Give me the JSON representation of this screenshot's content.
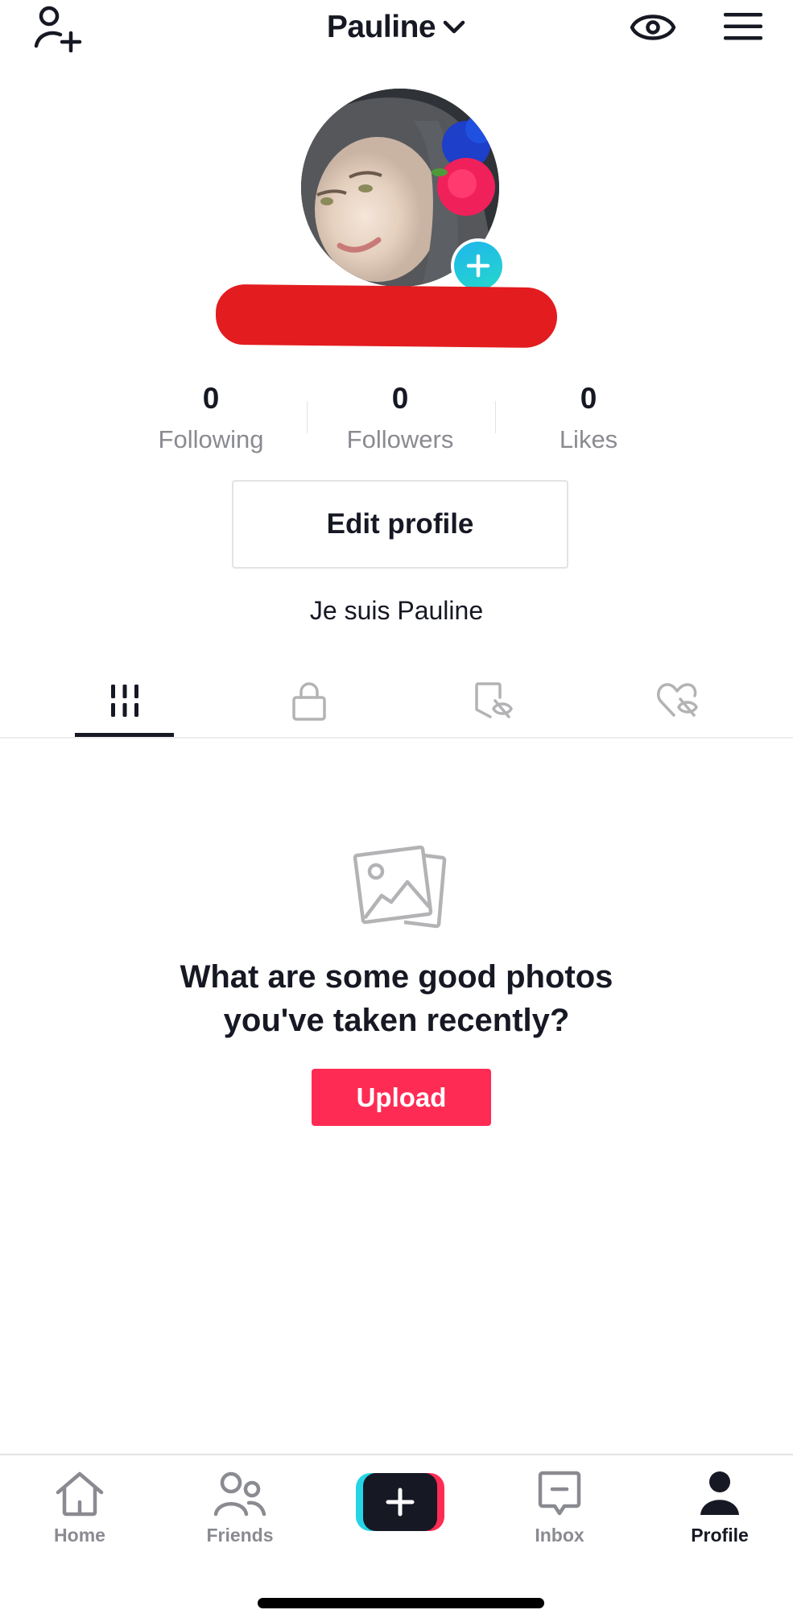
{
  "header": {
    "title": "Pauline",
    "icons": {
      "add_friend": "add-user-icon",
      "account_switch": "chevron-down-icon",
      "profile_views": "eye-icon",
      "menu": "hamburger-menu-icon"
    }
  },
  "profile": {
    "avatar": "avatar-photo",
    "avatar_badge": "plus-icon",
    "username": "",
    "stats": [
      {
        "value": "0",
        "label": "Following"
      },
      {
        "value": "0",
        "label": "Followers"
      },
      {
        "value": "0",
        "label": "Likes"
      }
    ],
    "edit_button": "Edit profile",
    "bio": "Je suis Pauline"
  },
  "tabs": [
    {
      "icon": "grid-icon",
      "active": true
    },
    {
      "icon": "lock-icon",
      "active": false
    },
    {
      "icon": "bookmark-hidden-icon",
      "active": false
    },
    {
      "icon": "heart-hidden-icon",
      "active": false
    }
  ],
  "empty_state": {
    "icon": "photos-icon",
    "heading_line1": "What are some good photos",
    "heading_line2": "you've taken recently?",
    "button": "Upload"
  },
  "nav": {
    "items": [
      {
        "label": "Home",
        "icon": "home-icon",
        "active": false
      },
      {
        "label": "Friends",
        "icon": "friends-icon",
        "active": false
      },
      {
        "label": "",
        "icon": "create-plus-icon",
        "active": false
      },
      {
        "label": "Inbox",
        "icon": "inbox-icon",
        "active": false
      },
      {
        "label": "Profile",
        "icon": "profile-icon",
        "active": true
      }
    ]
  },
  "colors": {
    "text": "#161823",
    "muted": "#8a8b91",
    "accent_pink": "#fe2c55",
    "accent_cyan": "#25d4e6",
    "redaction": "#e31c1f"
  }
}
